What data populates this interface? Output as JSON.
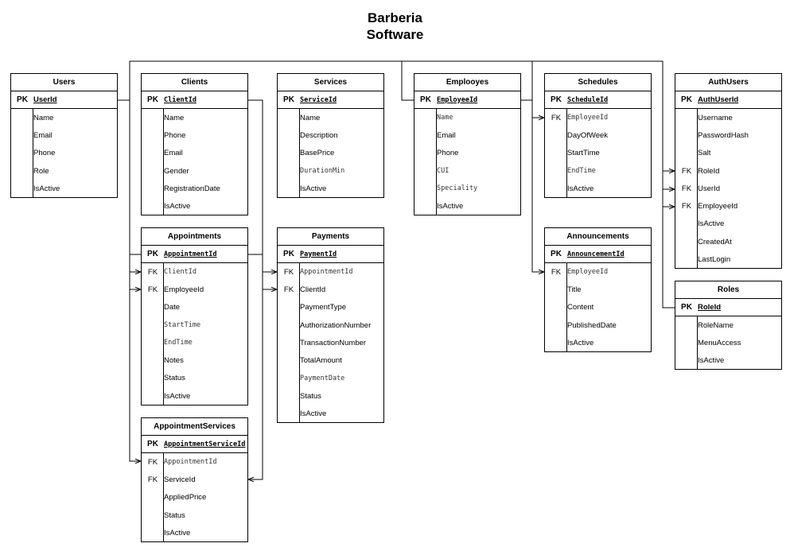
{
  "diagram": {
    "title_line1": "Barberia",
    "title_line2": "Software"
  },
  "tables": {
    "users": {
      "name": "Users",
      "fields": [
        {
          "key": "PK",
          "name": "UserId"
        },
        {
          "key": "",
          "name": "Name"
        },
        {
          "key": "",
          "name": "Email"
        },
        {
          "key": "",
          "name": "Phone"
        },
        {
          "key": "",
          "name": "Role"
        },
        {
          "key": "",
          "name": "IsActive"
        }
      ]
    },
    "clients": {
      "name": "Clients",
      "fields": [
        {
          "key": "PK",
          "name": "ClientId"
        },
        {
          "key": "",
          "name": "Name"
        },
        {
          "key": "",
          "name": "Phone"
        },
        {
          "key": "",
          "name": "Email"
        },
        {
          "key": "",
          "name": "Gender"
        },
        {
          "key": "",
          "name": "RegistrationDate"
        },
        {
          "key": "",
          "name": "IsActive"
        }
      ]
    },
    "services": {
      "name": "Services",
      "fields": [
        {
          "key": "PK",
          "name": "ServiceId"
        },
        {
          "key": "",
          "name": "Name"
        },
        {
          "key": "",
          "name": "Description"
        },
        {
          "key": "",
          "name": "BasePrice"
        },
        {
          "key": "",
          "name": "DurationMin"
        },
        {
          "key": "",
          "name": "IsActive"
        }
      ]
    },
    "employees": {
      "name": "Emplooyes",
      "fields": [
        {
          "key": "PK",
          "name": "EmployeeId"
        },
        {
          "key": "",
          "name": "Name"
        },
        {
          "key": "",
          "name": "Email"
        },
        {
          "key": "",
          "name": "Phone"
        },
        {
          "key": "",
          "name": "CUI"
        },
        {
          "key": "",
          "name": "Speciality"
        },
        {
          "key": "",
          "name": "IsActive"
        }
      ]
    },
    "schedules": {
      "name": "Schedules",
      "fields": [
        {
          "key": "PK",
          "name": "ScheduleId"
        },
        {
          "key": "FK",
          "name": "EmployeeId"
        },
        {
          "key": "",
          "name": "DayOfWeek"
        },
        {
          "key": "",
          "name": "StartTime"
        },
        {
          "key": "",
          "name": "EndTime"
        },
        {
          "key": "",
          "name": "IsActive"
        }
      ]
    },
    "authusers": {
      "name": "AuthUsers",
      "fields": [
        {
          "key": "PK",
          "name": "AuthUserId"
        },
        {
          "key": "",
          "name": "Username"
        },
        {
          "key": "",
          "name": "PasswordHash"
        },
        {
          "key": "",
          "name": "Salt"
        },
        {
          "key": "FK",
          "name": "RoleId"
        },
        {
          "key": "FK",
          "name": "UserId"
        },
        {
          "key": "FK",
          "name": "EmployeeId"
        },
        {
          "key": "",
          "name": "IsActive"
        },
        {
          "key": "",
          "name": "CreatedAt"
        },
        {
          "key": "",
          "name": "LastLogin"
        }
      ]
    },
    "appointments": {
      "name": "Appointments",
      "fields": [
        {
          "key": "PK",
          "name": "AppointmentId"
        },
        {
          "key": "FK",
          "name": "ClientId"
        },
        {
          "key": "FK",
          "name": "EmployeeId"
        },
        {
          "key": "",
          "name": "Date"
        },
        {
          "key": "",
          "name": "StartTime"
        },
        {
          "key": "",
          "name": "EndTime"
        },
        {
          "key": "",
          "name": "Notes"
        },
        {
          "key": "",
          "name": "Status"
        },
        {
          "key": "",
          "name": "IsActive"
        }
      ]
    },
    "payments": {
      "name": "Payments",
      "fields": [
        {
          "key": "PK",
          "name": "PaymentId"
        },
        {
          "key": "FK",
          "name": "AppointmentId"
        },
        {
          "key": "FK",
          "name": "ClientId"
        },
        {
          "key": "",
          "name": "PaymentType"
        },
        {
          "key": "",
          "name": "AuthorizationNumber"
        },
        {
          "key": "",
          "name": "TransactionNumber"
        },
        {
          "key": "",
          "name": "TotalAmount"
        },
        {
          "key": "",
          "name": "PaymentDate"
        },
        {
          "key": "",
          "name": "Status"
        },
        {
          "key": "",
          "name": "IsActive"
        }
      ]
    },
    "announcements": {
      "name": "Announcements",
      "fields": [
        {
          "key": "PK",
          "name": "AnnouncementId"
        },
        {
          "key": "FK",
          "name": "EmployeeId"
        },
        {
          "key": "",
          "name": "Title"
        },
        {
          "key": "",
          "name": "Content"
        },
        {
          "key": "",
          "name": "PublishedDate"
        },
        {
          "key": "",
          "name": "IsActive"
        }
      ]
    },
    "roles": {
      "name": "Roles",
      "fields": [
        {
          "key": "PK",
          "name": "RoleId"
        },
        {
          "key": "",
          "name": "RoleName"
        },
        {
          "key": "",
          "name": "MenuAccess"
        },
        {
          "key": "",
          "name": "IsActive"
        }
      ]
    },
    "appointmentservices": {
      "name": "AppointmentServices",
      "fields": [
        {
          "key": "PK",
          "name": "AppointmentServiceId"
        },
        {
          "key": "FK",
          "name": "AppointmentId"
        },
        {
          "key": "FK",
          "name": "ServiceId"
        },
        {
          "key": "",
          "name": "AppliedPrice"
        },
        {
          "key": "",
          "name": "Status"
        },
        {
          "key": "",
          "name": "IsActive"
        }
      ]
    }
  }
}
